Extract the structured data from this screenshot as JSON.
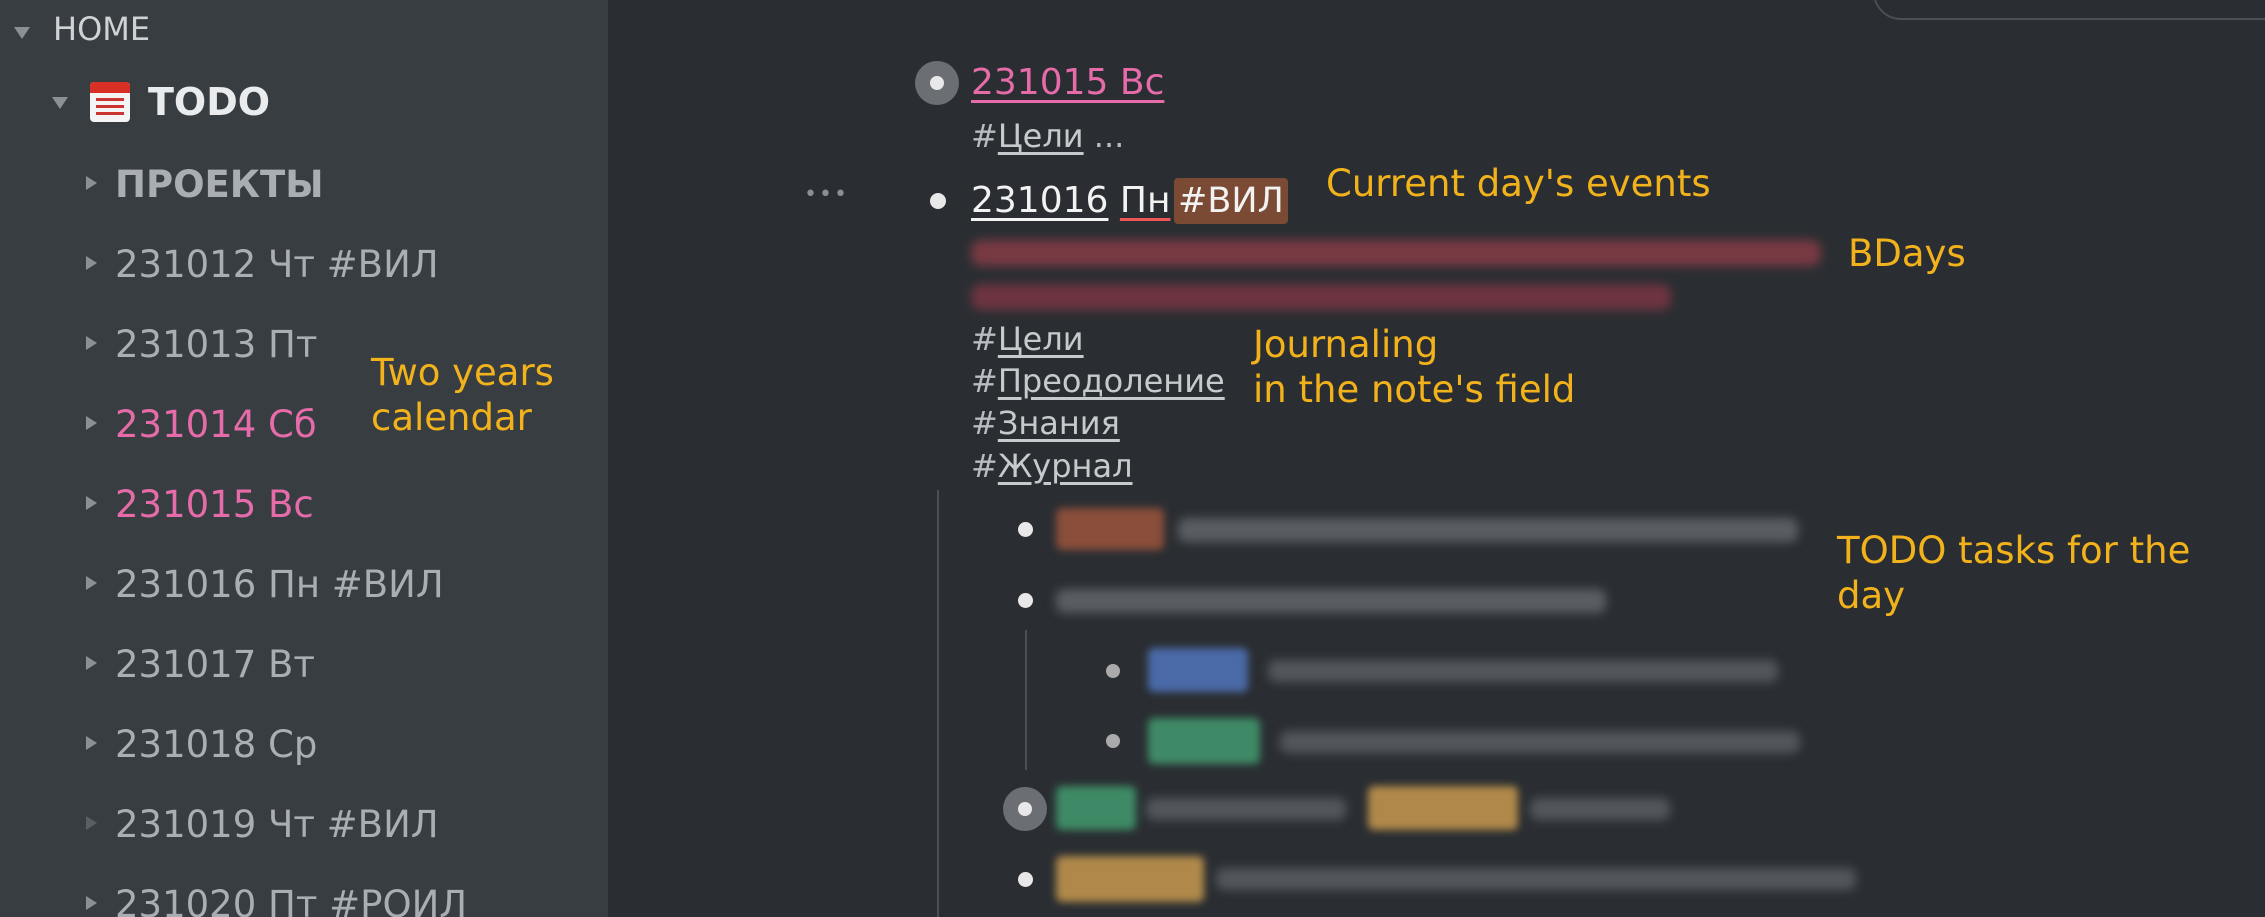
{
  "sidebar": {
    "home_label": "HOME",
    "todo_label": "TODO",
    "items": [
      {
        "label": "ПРОЕКТЫ",
        "style": "bold"
      },
      {
        "label": "231012 Чт #ВИЛ",
        "style": "normal"
      },
      {
        "label": "231013 Пт",
        "style": "normal"
      },
      {
        "label": "231014 Сб",
        "style": "pink"
      },
      {
        "label": "231015 Вс",
        "style": "pink"
      },
      {
        "label": "231016 Пн #ВИЛ",
        "style": "normal"
      },
      {
        "label": "231017 Вт",
        "style": "normal"
      },
      {
        "label": "231018 Ср",
        "style": "normal"
      },
      {
        "label": "231019 Чт #ВИЛ",
        "style": "normal"
      },
      {
        "label": "231020 Пт #РОИЛ",
        "style": "normal"
      }
    ]
  },
  "main": {
    "node1": {
      "title": "231015 Вс",
      "hash": "#",
      "tag": "Цели",
      "ellipsis": "..."
    },
    "node2": {
      "date": "231016",
      "weekday": "Пн",
      "badge": "#ВИЛ",
      "more": "•••",
      "tags": [
        {
          "hash": "#",
          "label": "Цели"
        },
        {
          "hash": "#",
          "label": "Преодоление"
        },
        {
          "hash": "#",
          "label": "Знания"
        },
        {
          "hash": "#",
          "label": "Журнал"
        }
      ]
    }
  },
  "annotations": {
    "current_day": "Current day's events",
    "bdays": "BDays",
    "journaling": "Journaling\nin the note's field",
    "calendar": "Two years\ncalendar",
    "todo_tasks": "TODO tasks for the\nday"
  },
  "colors": {
    "sidebar_bg": "#383d42",
    "main_bg": "#2a2e32",
    "pink": "#e56ba9",
    "annotation": "#f2b21b",
    "badge_bg": "#7b4a34"
  }
}
